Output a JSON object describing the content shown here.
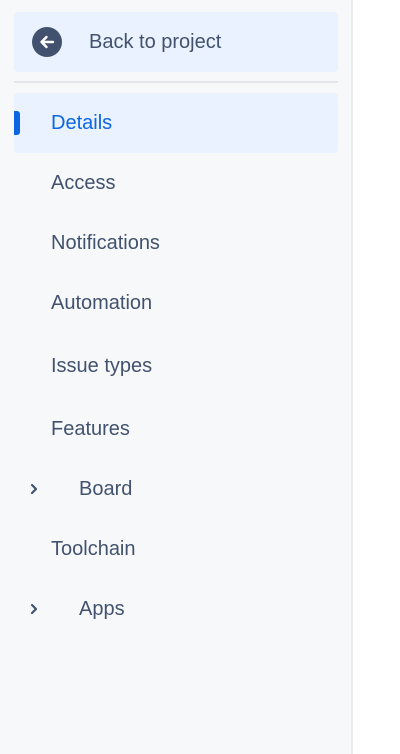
{
  "sidebar": {
    "back_label": "Back to project",
    "items": [
      {
        "label": "Details",
        "selected": true
      },
      {
        "label": "Access"
      },
      {
        "label": "Notifications"
      },
      {
        "label": "Automation"
      },
      {
        "label": "Issue types"
      },
      {
        "label": "Features"
      },
      {
        "label": "Board",
        "expandable": true
      },
      {
        "label": "Toolchain"
      },
      {
        "label": "Apps",
        "expandable": true
      }
    ]
  },
  "colors": {
    "accent": "#0c66e4",
    "selected_bg": "#e9f2fe",
    "text": "#42526e",
    "sidebar_bg": "#f7f8f9"
  }
}
